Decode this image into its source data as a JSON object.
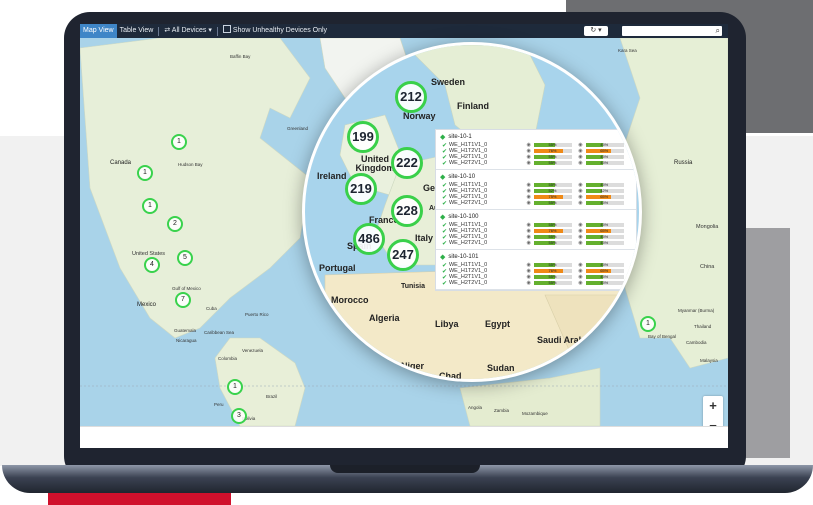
{
  "toolbar": {
    "map_view": "Map View",
    "table_view": "Table View",
    "devices_dropdown": "All Devices",
    "unhealthy_label": "Show Unhealthy Devices Only"
  },
  "map": {
    "labels": [
      "Baffin Bay",
      "Greenland",
      "Canada",
      "Hudson Bay",
      "United States",
      "Gulf of Mexico",
      "Mexico",
      "Cuba",
      "Puerto Rico",
      "Caribbean Sea",
      "Venezuela",
      "Colombia",
      "Peru",
      "Brazil",
      "Bolivia",
      "Labrador Sea",
      "Kara Sea",
      "Russia",
      "Mongolia",
      "China",
      "Thailand",
      "Myanmar (Burma)",
      "Malaysia",
      "Bay of Bengal",
      "Cambodia",
      "Nicaragua",
      "Guatemala",
      "Angola",
      "Zambia",
      "Mozambique"
    ],
    "pins": [
      "1",
      "1",
      "1",
      "2",
      "4",
      "5",
      "7",
      "1",
      "3",
      "1"
    ],
    "zoom_in": "+",
    "zoom_out": "−"
  },
  "magnifier": {
    "labels": [
      "Sweden",
      "Finland",
      "Norway",
      "United Kingdom",
      "Ireland",
      "Germany",
      "France",
      "Spain",
      "Italy",
      "Portugal",
      "Tunisia",
      "Morocco",
      "Algeria",
      "Libya",
      "Egypt",
      "Saudi Arabia",
      "Niger",
      "Chad",
      "Sudan",
      "Aust"
    ],
    "clusters": [
      "212",
      "199",
      "222",
      "219",
      "228",
      "486",
      "247"
    ]
  },
  "sites": [
    {
      "name": "site-10-1",
      "devices": [
        {
          "name": "WE_H1T1V1_0",
          "a": "55%",
          "b": "45%",
          "a_pct": 55,
          "b_pct": 45,
          "a_color": "#64b02e",
          "b_color": "#64b02e"
        },
        {
          "name": "WE_H1T2V1_0",
          "a": "76%",
          "b": "65%",
          "a_pct": 76,
          "b_pct": 65,
          "a_color": "#ef8a17",
          "b_color": "#ef8a17"
        },
        {
          "name": "WE_H2T1V1_0",
          "a": "55%",
          "b": "45%",
          "a_pct": 55,
          "b_pct": 45,
          "a_color": "#64b02e",
          "b_color": "#64b02e"
        },
        {
          "name": "WE_H2T2V1_0",
          "a": "55%",
          "b": "45%",
          "a_pct": 55,
          "b_pct": 45,
          "a_color": "#64b02e",
          "b_color": "#64b02e"
        }
      ]
    },
    {
      "name": "site-10-10",
      "devices": [
        {
          "name": "WE_H1T1V1_0",
          "a": "55%",
          "b": "45%",
          "a_pct": 55,
          "b_pct": 45,
          "a_color": "#64b02e",
          "b_color": "#64b02e"
        },
        {
          "name": "WE_H1T2V1_0",
          "a": "52%",
          "b": "42%",
          "a_pct": 52,
          "b_pct": 42,
          "a_color": "#64b02e",
          "b_color": "#64b02e"
        },
        {
          "name": "WE_H2T1V1_0",
          "a": "75%",
          "b": "65%",
          "a_pct": 75,
          "b_pct": 65,
          "a_color": "#ef8a17",
          "b_color": "#ef8a17"
        },
        {
          "name": "WE_H2T2V1_0",
          "a": "55%",
          "b": "45%",
          "a_pct": 55,
          "b_pct": 45,
          "a_color": "#64b02e",
          "b_color": "#64b02e"
        }
      ]
    },
    {
      "name": "site-10-100",
      "devices": [
        {
          "name": "WE_H1T1V1_0",
          "a": "55%",
          "b": "45%",
          "a_pct": 55,
          "b_pct": 45,
          "a_color": "#64b02e",
          "b_color": "#64b02e"
        },
        {
          "name": "WE_H1T2V1_0",
          "a": "76%",
          "b": "65%",
          "a_pct": 76,
          "b_pct": 65,
          "a_color": "#ef8a17",
          "b_color": "#ef8a17"
        },
        {
          "name": "WE_H2T1V1_0",
          "a": "55%",
          "b": "45%",
          "a_pct": 55,
          "b_pct": 45,
          "a_color": "#64b02e",
          "b_color": "#64b02e"
        },
        {
          "name": "WE_H2T2V1_0",
          "a": "55%",
          "b": "45%",
          "a_pct": 55,
          "b_pct": 45,
          "a_color": "#64b02e",
          "b_color": "#64b02e"
        }
      ]
    },
    {
      "name": "site-10-101",
      "devices": [
        {
          "name": "WE_H1T1V1_0",
          "a": "55%",
          "b": "45%",
          "a_pct": 55,
          "b_pct": 45,
          "a_color": "#64b02e",
          "b_color": "#64b02e"
        },
        {
          "name": "WE_H1T2V1_0",
          "a": "76%",
          "b": "65%",
          "a_pct": 76,
          "b_pct": 65,
          "a_color": "#ef8a17",
          "b_color": "#ef8a17"
        },
        {
          "name": "WE_H2T1V1_0",
          "a": "55%",
          "b": "45%",
          "a_pct": 55,
          "b_pct": 45,
          "a_color": "#64b02e",
          "b_color": "#64b02e"
        },
        {
          "name": "WE_H2T2V1_0",
          "a": "55%",
          "b": "45%",
          "a_pct": 55,
          "b_pct": 45,
          "a_color": "#64b02e",
          "b_color": "#64b02e"
        }
      ]
    }
  ],
  "colors": {
    "healthy": "#64b02e",
    "warning": "#ef8a17",
    "cluster_ring": "#3ad04a",
    "toolbar_bg": "#1e2a3b",
    "active_tab": "#3f86c7"
  }
}
